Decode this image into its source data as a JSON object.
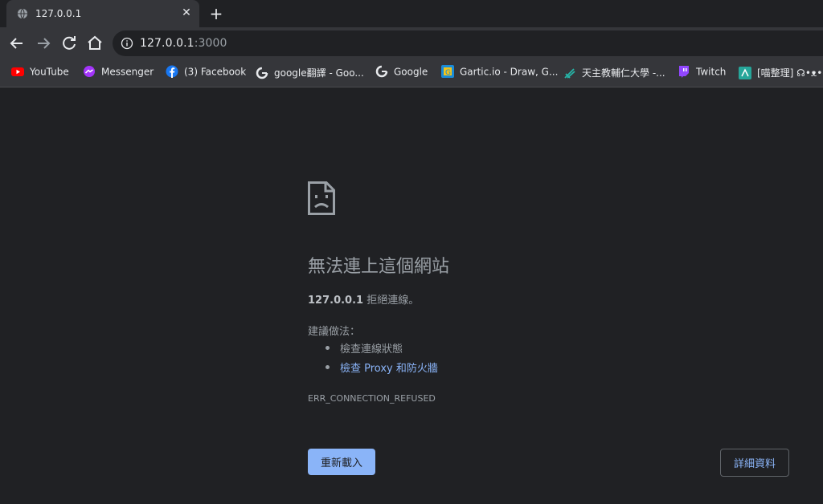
{
  "tab": {
    "title": "127.0.0.1",
    "favicon": "globe-icon"
  },
  "toolbar": {
    "back_icon": "back-arrow-icon",
    "forward_icon": "forward-arrow-icon",
    "reload_icon": "reload-icon",
    "home_icon": "home-icon"
  },
  "omnibox": {
    "host": "127.0.0.1",
    "port": ":3000",
    "info_icon": "info-icon"
  },
  "bookmarks": [
    {
      "label": "YouTube",
      "icon": "youtube-icon"
    },
    {
      "label": "Messenger",
      "icon": "messenger-icon"
    },
    {
      "label": "(3) Facebook",
      "icon": "facebook-icon"
    },
    {
      "label": "google翻譯 - Goo...",
      "icon": "google-icon"
    },
    {
      "label": "Google",
      "icon": "google-icon"
    },
    {
      "label": "Gartic.io - Draw, G...",
      "icon": "gartic-icon"
    },
    {
      "label": "天主教輔仁大學 -...",
      "icon": "fju-icon"
    },
    {
      "label": "Twitch",
      "icon": "twitch-icon"
    },
    {
      "label": "[喵整理] ☊•ᴥ•ᴗ• 日",
      "icon": "bookmark-icon"
    }
  ],
  "error": {
    "title": "無法連上這個網站",
    "host": "127.0.0.1",
    "summary_suffix": " 拒絕連線。",
    "suggest_heading": "建議做法：",
    "suggestions": [
      "檢查連線狀態",
      "檢查 Proxy 和防火牆"
    ],
    "code": "ERR_CONNECTION_REFUSED"
  },
  "buttons": {
    "reload": "重新載入",
    "details": "詳細資料"
  },
  "colors": {
    "background": "#202124",
    "accent": "#8ab4f8",
    "toolbar": "#35363a"
  }
}
